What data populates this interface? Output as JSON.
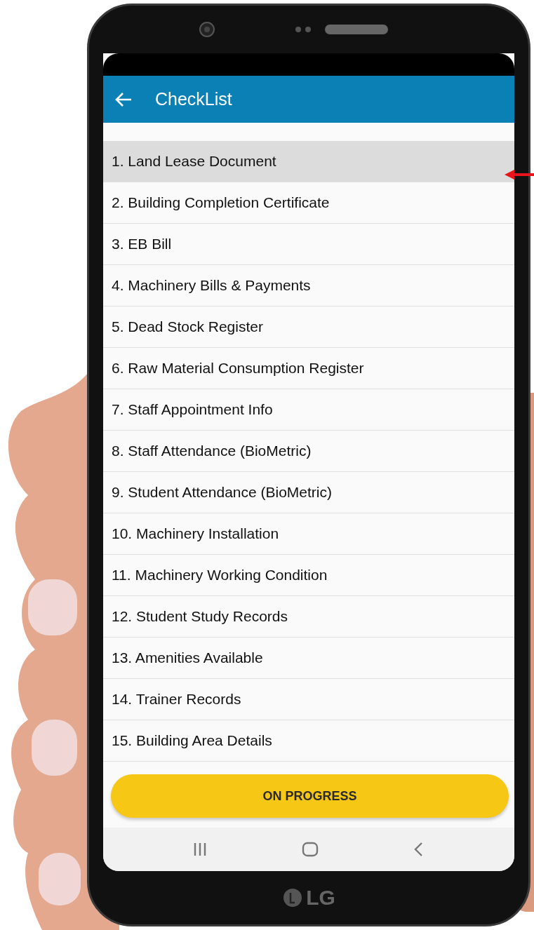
{
  "app_bar": {
    "title": "CheckList"
  },
  "items": [
    {
      "label": "1. Land Lease Document",
      "selected": true
    },
    {
      "label": "2. Building Completion Certificate",
      "selected": false
    },
    {
      "label": "3. EB Bill",
      "selected": false
    },
    {
      "label": "4. Machinery Bills & Payments",
      "selected": false
    },
    {
      "label": "5. Dead Stock Register",
      "selected": false
    },
    {
      "label": "6. Raw Material Consumption Register",
      "selected": false
    },
    {
      "label": "7. Staff Appointment Info",
      "selected": false
    },
    {
      "label": "8. Staff Attendance (BioMetric)",
      "selected": false
    },
    {
      "label": "9. Student Attendance (BioMetric)",
      "selected": false
    },
    {
      "label": "10. Machinery Installation",
      "selected": false
    },
    {
      "label": "11. Machinery Working Condition",
      "selected": false
    },
    {
      "label": "12. Student Study Records",
      "selected": false
    },
    {
      "label": "13. Amenities Available",
      "selected": false
    },
    {
      "label": "14. Trainer Records",
      "selected": false
    },
    {
      "label": "15. Building Area Details",
      "selected": false
    }
  ],
  "button": {
    "label": "ON PROGRESS"
  },
  "phone": {
    "brand": "LG"
  }
}
